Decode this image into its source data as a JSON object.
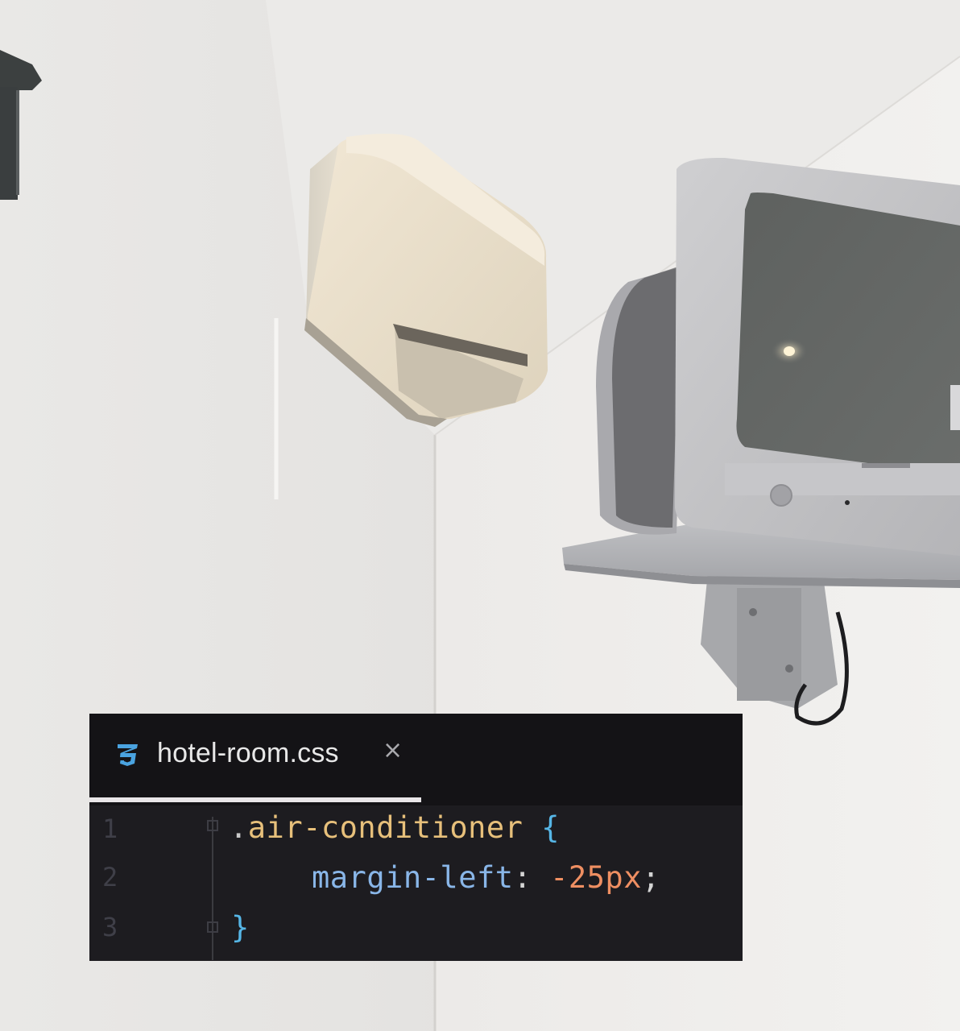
{
  "scene": {
    "background": "#e7e6e3",
    "objects": [
      "wall-lamp",
      "air-conditioner",
      "crt-television",
      "tv-wall-bracket"
    ]
  },
  "editor": {
    "tab": {
      "icon": "css3-icon",
      "filename": "hotel-room.css",
      "close": "×"
    },
    "line_numbers": [
      "1",
      "2",
      "3"
    ],
    "code": {
      "line1": {
        "dot": ".",
        "selector": "air-conditioner",
        "brace": "{"
      },
      "line2": {
        "property": "margin-left",
        "colon": ":",
        "value": "-25px",
        "semicolon": ";"
      },
      "line3": {
        "brace": "}"
      }
    },
    "colors": {
      "selector": "#e7c07b",
      "property": "#89b6e8",
      "value": "#ef8f62",
      "brace": "#56b6e6",
      "icon": "#4aa3e0"
    }
  }
}
